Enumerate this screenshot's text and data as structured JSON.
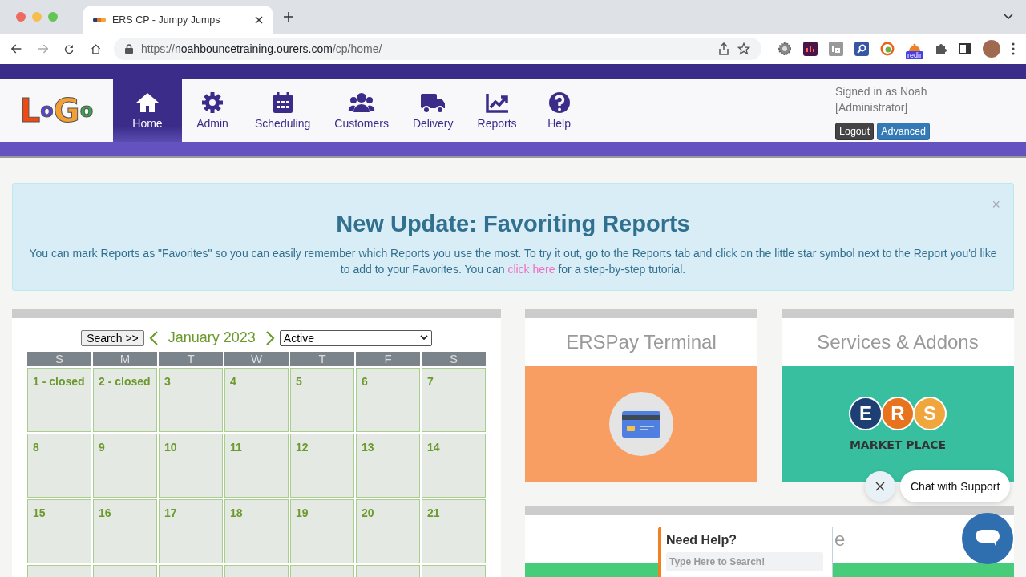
{
  "browser": {
    "tab_title": "ERS CP - Jumpy Jumps",
    "url_scheme": "https://",
    "url_host": "noahbouncetraining.ourers.com",
    "url_path": "/cp/home/",
    "extension_badge": "redir"
  },
  "header": {
    "logo_letters": [
      {
        "char": "L",
        "color": "#f04a12"
      },
      {
        "char": "o",
        "color": "#5b3fe0"
      },
      {
        "char": "G",
        "color": "#f2a033"
      },
      {
        "char": "o",
        "color": "#35a84a"
      }
    ],
    "nav": [
      {
        "label": "Home",
        "selected": true
      },
      {
        "label": "Admin",
        "selected": false
      },
      {
        "label": "Scheduling",
        "selected": false
      },
      {
        "label": "Customers",
        "selected": false
      },
      {
        "label": "Delivery",
        "selected": false
      },
      {
        "label": "Reports",
        "selected": false
      },
      {
        "label": "Help",
        "selected": false
      }
    ],
    "user_line1": "Signed in as Noah",
    "user_line2": "[Administrator]",
    "buttons": [
      "Logout",
      "Advanced"
    ]
  },
  "alert": {
    "close": "×",
    "title": "New Update: Favoriting Reports",
    "text_before": "You can mark Reports as \"Favorites\" so you can easily remember which Reports you use the most. To try it out, go to the Reports tab and click on the little star symbol next to the Report you'd like to add to your Favorites. You can ",
    "link": "click here",
    "text_after": " for a step-by-step tutorial."
  },
  "calendar": {
    "search_button": "Search >>",
    "month": "January 2023",
    "filter": "Active",
    "weekdays": [
      "S",
      "M",
      "T",
      "W",
      "T",
      "F",
      "S"
    ],
    "weeks": [
      [
        "1 - **closed**",
        "2 - **closed**",
        "3",
        "4",
        "5",
        "6",
        "7"
      ],
      [
        "8",
        "9",
        "10",
        "11",
        "12",
        "13",
        "14"
      ],
      [
        "15",
        "16",
        "17",
        "18",
        "19",
        "20",
        "21"
      ]
    ]
  },
  "cards": [
    {
      "title": "ERSPay Terminal"
    },
    {
      "title": "Services & Addons",
      "logo_letters": [
        "E",
        "R",
        "S"
      ],
      "logo_caption": "MARKET PLACE"
    }
  ],
  "lower_card": {
    "title_visible": "e"
  },
  "help_popup": {
    "title": "Need Help?",
    "placeholder": "Type Here to Search!"
  },
  "chat": {
    "label": "Chat with Support"
  }
}
